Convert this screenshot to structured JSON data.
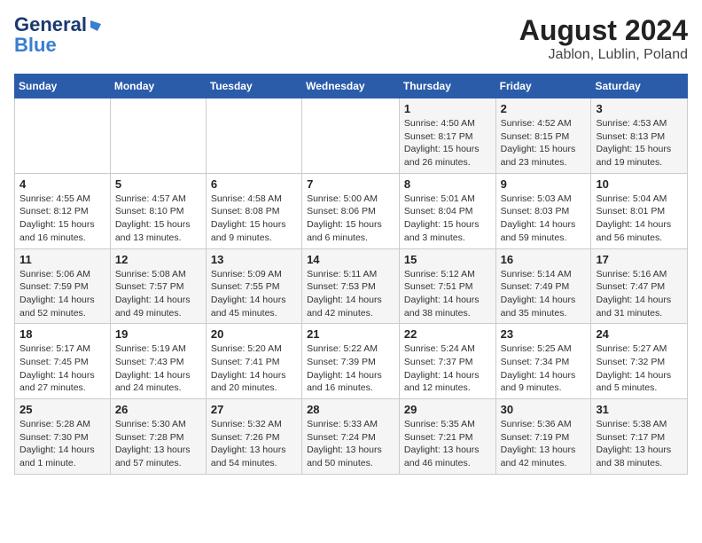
{
  "header": {
    "logo_line1": "General",
    "logo_line2": "Blue",
    "title": "August 2024",
    "subtitle": "Jablon, Lublin, Poland"
  },
  "days_of_week": [
    "Sunday",
    "Monday",
    "Tuesday",
    "Wednesday",
    "Thursday",
    "Friday",
    "Saturday"
  ],
  "weeks": [
    [
      {
        "day": "",
        "info": ""
      },
      {
        "day": "",
        "info": ""
      },
      {
        "day": "",
        "info": ""
      },
      {
        "day": "",
        "info": ""
      },
      {
        "day": "1",
        "info": "Sunrise: 4:50 AM\nSunset: 8:17 PM\nDaylight: 15 hours\nand 26 minutes."
      },
      {
        "day": "2",
        "info": "Sunrise: 4:52 AM\nSunset: 8:15 PM\nDaylight: 15 hours\nand 23 minutes."
      },
      {
        "day": "3",
        "info": "Sunrise: 4:53 AM\nSunset: 8:13 PM\nDaylight: 15 hours\nand 19 minutes."
      }
    ],
    [
      {
        "day": "4",
        "info": "Sunrise: 4:55 AM\nSunset: 8:12 PM\nDaylight: 15 hours\nand 16 minutes."
      },
      {
        "day": "5",
        "info": "Sunrise: 4:57 AM\nSunset: 8:10 PM\nDaylight: 15 hours\nand 13 minutes."
      },
      {
        "day": "6",
        "info": "Sunrise: 4:58 AM\nSunset: 8:08 PM\nDaylight: 15 hours\nand 9 minutes."
      },
      {
        "day": "7",
        "info": "Sunrise: 5:00 AM\nSunset: 8:06 PM\nDaylight: 15 hours\nand 6 minutes."
      },
      {
        "day": "8",
        "info": "Sunrise: 5:01 AM\nSunset: 8:04 PM\nDaylight: 15 hours\nand 3 minutes."
      },
      {
        "day": "9",
        "info": "Sunrise: 5:03 AM\nSunset: 8:03 PM\nDaylight: 14 hours\nand 59 minutes."
      },
      {
        "day": "10",
        "info": "Sunrise: 5:04 AM\nSunset: 8:01 PM\nDaylight: 14 hours\nand 56 minutes."
      }
    ],
    [
      {
        "day": "11",
        "info": "Sunrise: 5:06 AM\nSunset: 7:59 PM\nDaylight: 14 hours\nand 52 minutes."
      },
      {
        "day": "12",
        "info": "Sunrise: 5:08 AM\nSunset: 7:57 PM\nDaylight: 14 hours\nand 49 minutes."
      },
      {
        "day": "13",
        "info": "Sunrise: 5:09 AM\nSunset: 7:55 PM\nDaylight: 14 hours\nand 45 minutes."
      },
      {
        "day": "14",
        "info": "Sunrise: 5:11 AM\nSunset: 7:53 PM\nDaylight: 14 hours\nand 42 minutes."
      },
      {
        "day": "15",
        "info": "Sunrise: 5:12 AM\nSunset: 7:51 PM\nDaylight: 14 hours\nand 38 minutes."
      },
      {
        "day": "16",
        "info": "Sunrise: 5:14 AM\nSunset: 7:49 PM\nDaylight: 14 hours\nand 35 minutes."
      },
      {
        "day": "17",
        "info": "Sunrise: 5:16 AM\nSunset: 7:47 PM\nDaylight: 14 hours\nand 31 minutes."
      }
    ],
    [
      {
        "day": "18",
        "info": "Sunrise: 5:17 AM\nSunset: 7:45 PM\nDaylight: 14 hours\nand 27 minutes."
      },
      {
        "day": "19",
        "info": "Sunrise: 5:19 AM\nSunset: 7:43 PM\nDaylight: 14 hours\nand 24 minutes."
      },
      {
        "day": "20",
        "info": "Sunrise: 5:20 AM\nSunset: 7:41 PM\nDaylight: 14 hours\nand 20 minutes."
      },
      {
        "day": "21",
        "info": "Sunrise: 5:22 AM\nSunset: 7:39 PM\nDaylight: 14 hours\nand 16 minutes."
      },
      {
        "day": "22",
        "info": "Sunrise: 5:24 AM\nSunset: 7:37 PM\nDaylight: 14 hours\nand 12 minutes."
      },
      {
        "day": "23",
        "info": "Sunrise: 5:25 AM\nSunset: 7:34 PM\nDaylight: 14 hours\nand 9 minutes."
      },
      {
        "day": "24",
        "info": "Sunrise: 5:27 AM\nSunset: 7:32 PM\nDaylight: 14 hours\nand 5 minutes."
      }
    ],
    [
      {
        "day": "25",
        "info": "Sunrise: 5:28 AM\nSunset: 7:30 PM\nDaylight: 14 hours\nand 1 minute."
      },
      {
        "day": "26",
        "info": "Sunrise: 5:30 AM\nSunset: 7:28 PM\nDaylight: 13 hours\nand 57 minutes."
      },
      {
        "day": "27",
        "info": "Sunrise: 5:32 AM\nSunset: 7:26 PM\nDaylight: 13 hours\nand 54 minutes."
      },
      {
        "day": "28",
        "info": "Sunrise: 5:33 AM\nSunset: 7:24 PM\nDaylight: 13 hours\nand 50 minutes."
      },
      {
        "day": "29",
        "info": "Sunrise: 5:35 AM\nSunset: 7:21 PM\nDaylight: 13 hours\nand 46 minutes."
      },
      {
        "day": "30",
        "info": "Sunrise: 5:36 AM\nSunset: 7:19 PM\nDaylight: 13 hours\nand 42 minutes."
      },
      {
        "day": "31",
        "info": "Sunrise: 5:38 AM\nSunset: 7:17 PM\nDaylight: 13 hours\nand 38 minutes."
      }
    ]
  ]
}
